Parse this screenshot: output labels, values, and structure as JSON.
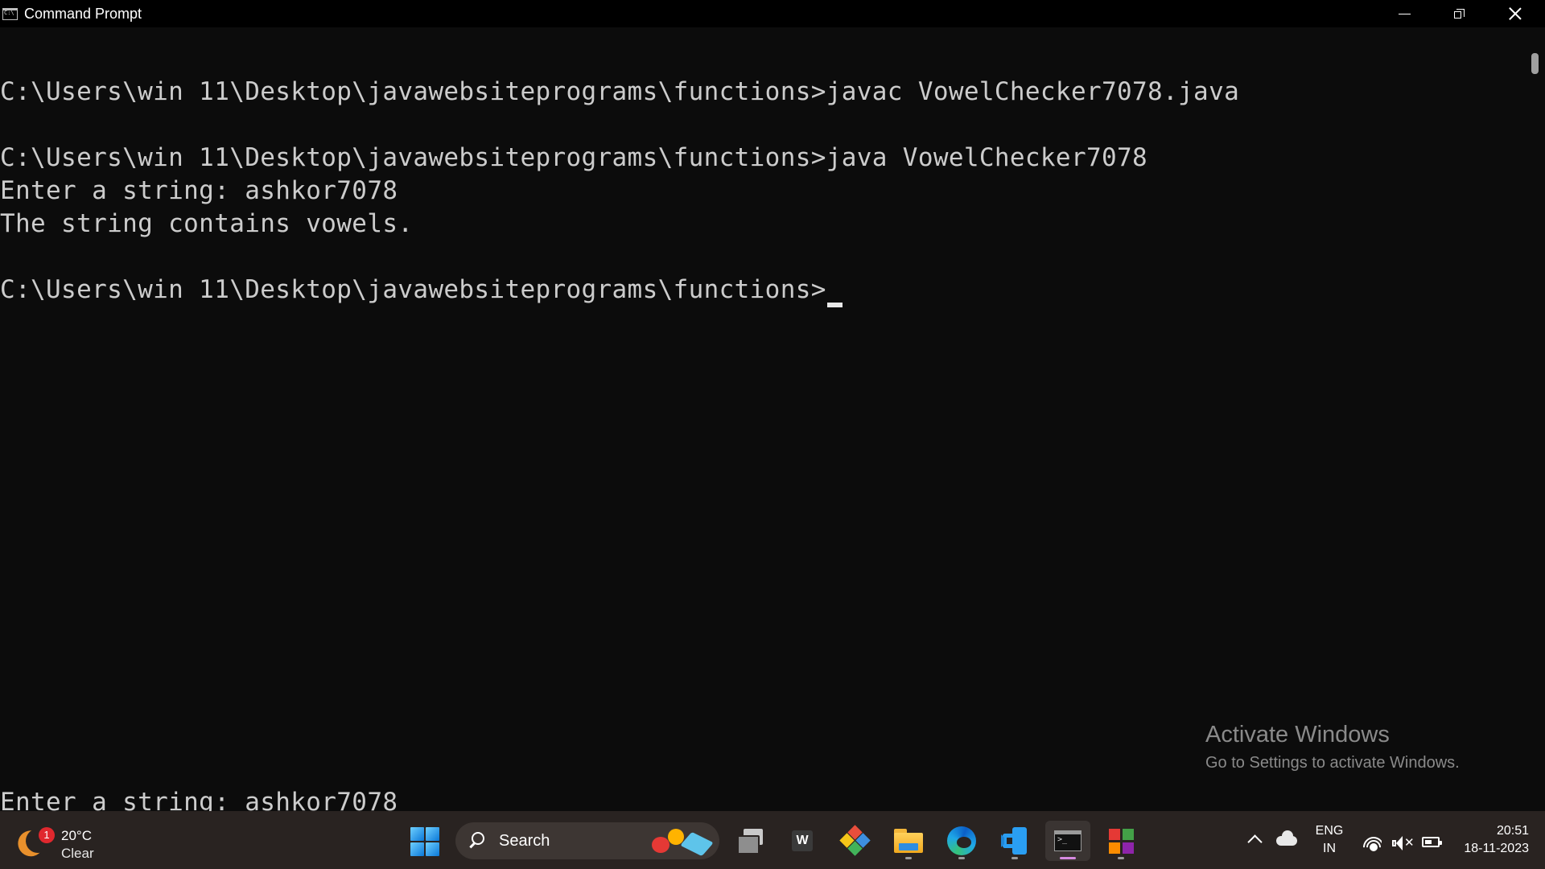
{
  "window": {
    "title": "Command Prompt",
    "icon": "cmd-icon",
    "controls": [
      "minimize-icon",
      "restore-icon",
      "close-icon"
    ]
  },
  "console": {
    "lines": [
      "",
      "C:\\Users\\win 11\\Desktop\\javawebsiteprograms\\functions>javac VowelChecker7078.java",
      "",
      "C:\\Users\\win 11\\Desktop\\javawebsiteprograms\\functions>java VowelChecker7078",
      "Enter a string: ashkor7078",
      "The string contains vowels.",
      "",
      "C:\\Users\\win 11\\Desktop\\javawebsiteprograms\\functions>"
    ],
    "bottom_line": "Enter a string: ashkor7078"
  },
  "watermark": {
    "title": "Activate Windows",
    "subtitle": "Go to Settings to activate Windows."
  },
  "taskbar": {
    "weather": {
      "badge": "1",
      "temp": "20°C",
      "condition": "Clear",
      "icon": "moon-icon"
    },
    "search": {
      "label": "Search"
    },
    "apps": [
      {
        "name": "task-view-icon",
        "active": false
      },
      {
        "name": "word-icon",
        "label": "W",
        "active": false
      },
      {
        "name": "git-icon",
        "active": false
      },
      {
        "name": "file-explorer-icon",
        "active": false
      },
      {
        "name": "edge-icon",
        "active": false
      },
      {
        "name": "vscode-icon",
        "active": false
      },
      {
        "name": "command-prompt-icon",
        "active": true
      },
      {
        "name": "office-icon",
        "active": false
      }
    ],
    "tray": {
      "lang_top": "ENG",
      "lang_bottom": "IN",
      "time": "20:51",
      "date": "18-11-2023"
    }
  },
  "colors": {
    "console_bg": "#0c0c0c",
    "console_text": "#cccccc",
    "titlebar_bg": "#000000",
    "taskbar_bg": "#292321"
  }
}
